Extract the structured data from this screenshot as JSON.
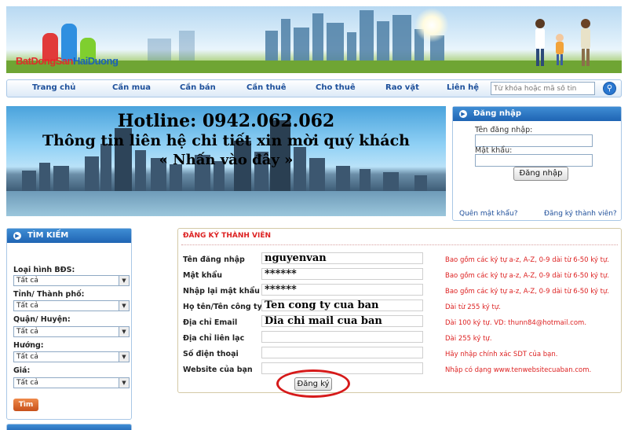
{
  "header": {
    "logo_part1": "BatDongSan",
    "logo_part2": "HaiDuong"
  },
  "nav": {
    "items": [
      "Trang chủ",
      "Cần mua",
      "Cần bán",
      "Cần thuê",
      "Cho thuê",
      "Rao vặt",
      "Liên hệ"
    ],
    "search_placeholder": "Từ khóa hoặc mã số tin"
  },
  "banner": {
    "line1": "Hotline: 0942.062.062",
    "line2": "Thông tin liên hệ chi tiết xin mời quý khách",
    "line3": "« Nhấn vào đây »"
  },
  "login": {
    "title": "Đăng nhập",
    "username_label": "Tên đăng nhập:",
    "password_label": "Mật khẩu:",
    "submit": "Đăng nhập",
    "forgot": "Quên mật khẩu?",
    "register": "Đăng ký thành viên?"
  },
  "search": {
    "title": "TÌM KIẾM",
    "fields": [
      {
        "label": "Loại hình BĐS:",
        "value": "Tất cả"
      },
      {
        "label": "Tỉnh/ Thành phố:",
        "value": "Tất cả"
      },
      {
        "label": "Quận/ Huyện:",
        "value": "Tất cả"
      },
      {
        "label": "Hướng:",
        "value": "Tất cả"
      },
      {
        "label": "Giá:",
        "value": "Tất cả"
      }
    ],
    "button": "Tìm"
  },
  "register": {
    "title": "ĐĂNG KÝ THÀNH VIÊN",
    "rows": [
      {
        "label": "Tên đăng nhập",
        "value": "nguyenvan",
        "hint": "Bao gồm các ký tự a-z, A-Z, 0-9 dài từ 6-50 ký tự."
      },
      {
        "label": "Mật khẩu",
        "value": "******",
        "hint": "Bao gồm các ký tự a-z, A-Z, 0-9 dài từ 6-50 ký tự."
      },
      {
        "label": "Nhập lại mật khẩu",
        "value": "******",
        "hint": "Bao gồm các ký tự a-z, A-Z, 0-9 dài từ 6-50 ký tự."
      },
      {
        "label": "Họ tên/Tên công ty",
        "value": "Ten cong ty cua ban",
        "hint": "Dài từ 255 ký tự."
      },
      {
        "label": "Địa chỉ Email",
        "value": "Dia chi mail cua ban",
        "hint": "Dài 100 ký tự. VD: thunn84@hotmail.com."
      },
      {
        "label": "Địa chỉ liên lạc",
        "value": "",
        "hint": "Dài 255 ký tự."
      },
      {
        "label": "Số điện thoại",
        "value": "",
        "hint": "Hãy nhập chính xác SDT của bạn."
      },
      {
        "label": "Website của bạn",
        "value": "",
        "hint": "Nhập có dạng www.tenwebsitecuaban.com."
      }
    ],
    "submit": "Đăng ký"
  },
  "colors": {
    "nav_text": "#1d4f9a",
    "box_header": "#1f64b3",
    "hint_red": "#dd2222",
    "annotation_red": "#d61a1a"
  }
}
